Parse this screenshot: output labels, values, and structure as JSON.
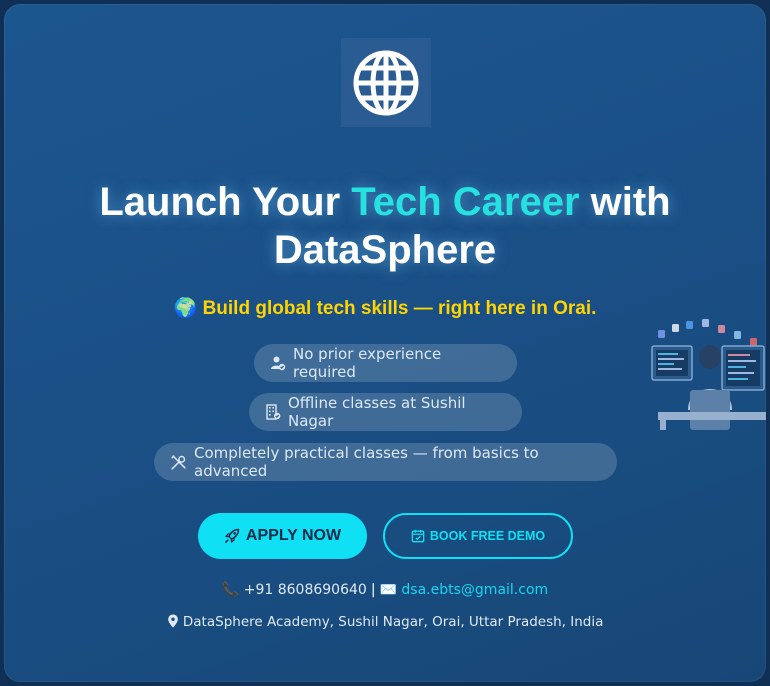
{
  "logo": {
    "icon": "globe-icon"
  },
  "hero": {
    "title_part1": "Launch Your ",
    "title_accent": "Tech Career",
    "title_part2": " with DataSphere",
    "subtitle_emoji": "🌍",
    "subtitle": "Build global tech skills — right here in Orai."
  },
  "features": [
    {
      "icon": "user-check-icon",
      "label": "No prior experience required"
    },
    {
      "icon": "building-icon",
      "label": "Offline classes at Sushil Nagar"
    },
    {
      "icon": "tools-icon",
      "label": "Completely practical classes — from basics to advanced"
    }
  ],
  "buttons": {
    "apply_label": "APPLY NOW",
    "apply_icon": "rocket-icon",
    "demo_label": "BOOK FREE DEMO",
    "demo_icon": "calendar-check-icon"
  },
  "contact": {
    "phone_emoji": "📞",
    "phone": "+91 8608690640",
    "separator": "|",
    "email_emoji": "✉️",
    "email": "dsa.ebts@gmail.com",
    "address_icon": "map-pin-icon",
    "address": "DataSphere Academy, Sushil Nagar, Orai, Uttar Pradesh, India"
  },
  "colors": {
    "background": "#1a4f85",
    "accent": "#25e2e0",
    "subtitle": "#ffd400",
    "button": "#0fe0f3"
  }
}
